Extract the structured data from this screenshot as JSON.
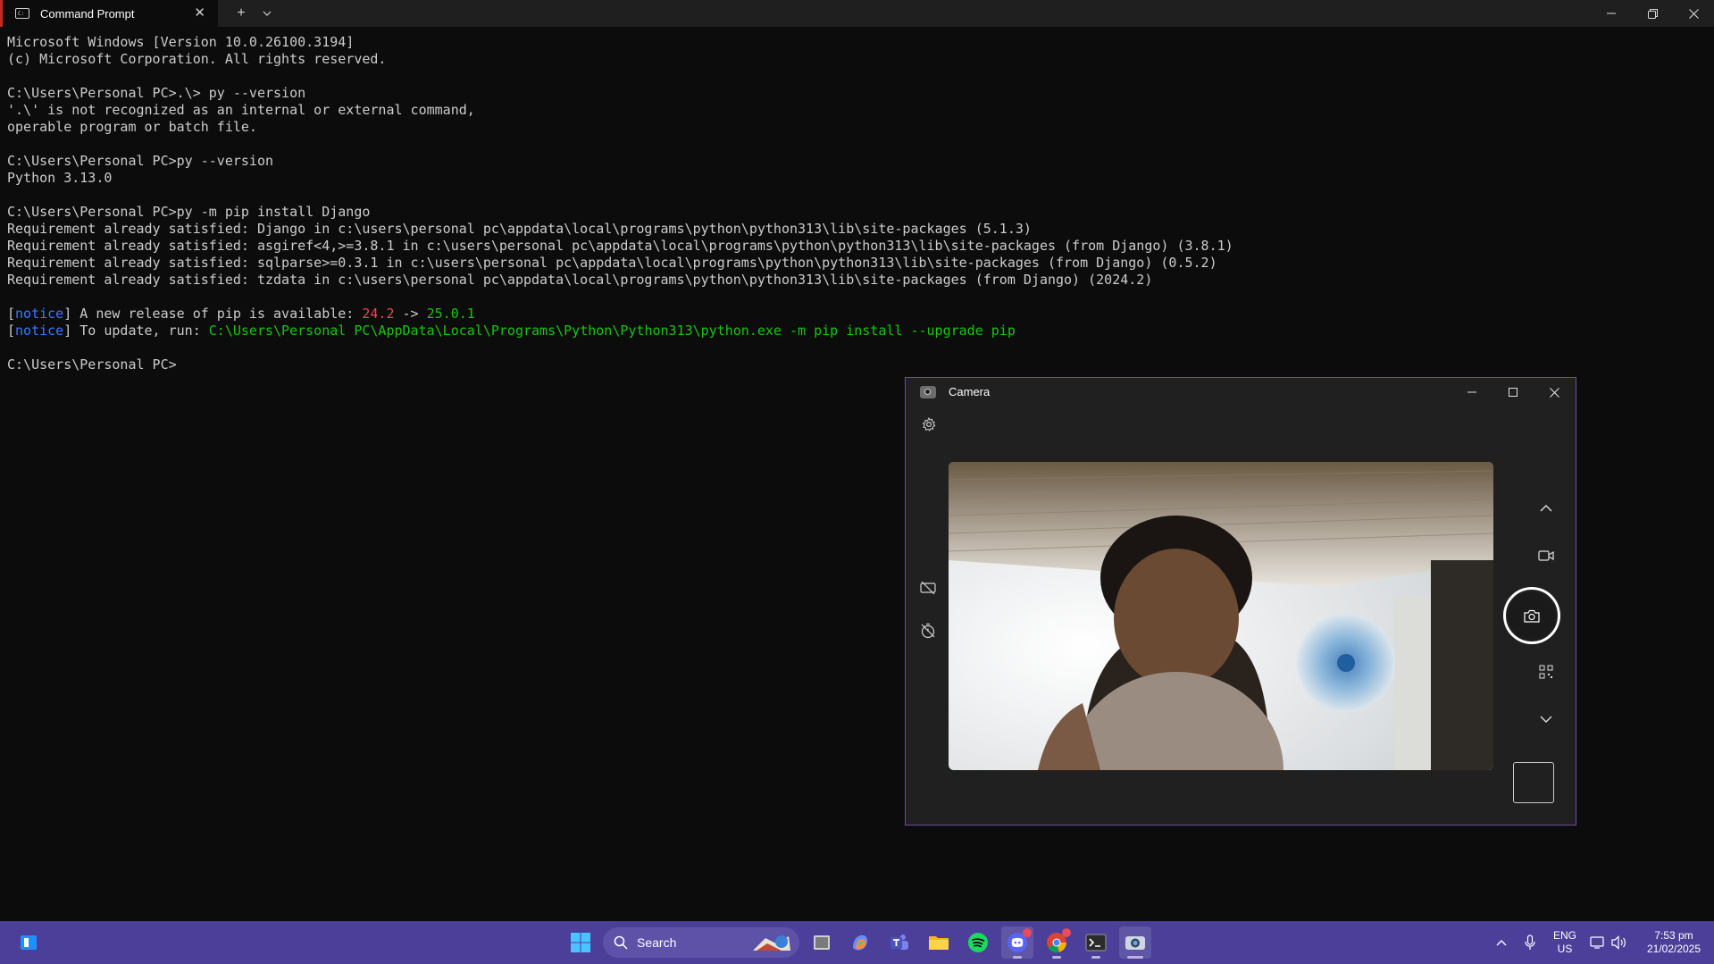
{
  "terminal": {
    "tab_title": "Command Prompt",
    "new_tab": "+",
    "dropdown": "⌄",
    "close": "✕",
    "lines": [
      {
        "segments": [
          {
            "t": "Microsoft Windows [Version 10.0.26100.3194]",
            "c": ""
          }
        ]
      },
      {
        "segments": [
          {
            "t": "(c) Microsoft Corporation. All rights reserved.",
            "c": ""
          }
        ]
      },
      {
        "segments": [
          {
            "t": "",
            "c": ""
          }
        ]
      },
      {
        "segments": [
          {
            "t": "C:\\Users\\Personal PC>.\\> py --version",
            "c": ""
          }
        ]
      },
      {
        "segments": [
          {
            "t": "'.\\' is not recognized as an internal or external command,",
            "c": ""
          }
        ]
      },
      {
        "segments": [
          {
            "t": "operable program or batch file.",
            "c": ""
          }
        ]
      },
      {
        "segments": [
          {
            "t": "",
            "c": ""
          }
        ]
      },
      {
        "segments": [
          {
            "t": "C:\\Users\\Personal PC>py --version",
            "c": ""
          }
        ]
      },
      {
        "segments": [
          {
            "t": "Python 3.13.0",
            "c": ""
          }
        ]
      },
      {
        "segments": [
          {
            "t": "",
            "c": ""
          }
        ]
      },
      {
        "segments": [
          {
            "t": "C:\\Users\\Personal PC>py -m pip install Django",
            "c": ""
          }
        ]
      },
      {
        "segments": [
          {
            "t": "Requirement already satisfied: Django in c:\\users\\personal pc\\appdata\\local\\programs\\python\\python313\\lib\\site-packages (5.1.3)",
            "c": ""
          }
        ]
      },
      {
        "segments": [
          {
            "t": "Requirement already satisfied: asgiref<4,>=3.8.1 in c:\\users\\personal pc\\appdata\\local\\programs\\python\\python313\\lib\\site-packages (from Django) (3.8.1)",
            "c": ""
          }
        ]
      },
      {
        "segments": [
          {
            "t": "Requirement already satisfied: sqlparse>=0.3.1 in c:\\users\\personal pc\\appdata\\local\\programs\\python\\python313\\lib\\site-packages (from Django) (0.5.2)",
            "c": ""
          }
        ]
      },
      {
        "segments": [
          {
            "t": "Requirement already satisfied: tzdata in c:\\users\\personal pc\\appdata\\local\\programs\\python\\python313\\lib\\site-packages (from Django) (2024.2)",
            "c": ""
          }
        ]
      },
      {
        "segments": [
          {
            "t": "",
            "c": ""
          }
        ]
      },
      {
        "segments": [
          {
            "t": "[",
            "c": ""
          },
          {
            "t": "notice",
            "c": "c-blue"
          },
          {
            "t": "] A new release of pip is available: ",
            "c": ""
          },
          {
            "t": "24.2",
            "c": "c-red"
          },
          {
            "t": " -> ",
            "c": ""
          },
          {
            "t": "25.0.1",
            "c": "c-green"
          }
        ]
      },
      {
        "segments": [
          {
            "t": "[",
            "c": ""
          },
          {
            "t": "notice",
            "c": "c-blue"
          },
          {
            "t": "] To update, run: ",
            "c": ""
          },
          {
            "t": "C:\\Users\\Personal PC\\AppData\\Local\\Programs\\Python\\Python313\\python.exe -m pip install --upgrade pip",
            "c": "c-green"
          }
        ]
      },
      {
        "segments": [
          {
            "t": "",
            "c": ""
          }
        ]
      },
      {
        "segments": [
          {
            "t": "C:\\Users\\Personal PC>",
            "c": ""
          }
        ]
      }
    ]
  },
  "camera": {
    "title": "Camera"
  },
  "taskbar": {
    "search_label": "Search",
    "language_top": "ENG",
    "language_bottom": "US",
    "time": "7:53 pm",
    "date": "21/02/2025"
  },
  "colors": {
    "console_bg": "#0c0c0c",
    "console_text": "#cccccc",
    "notice_blue": "#3b78ff",
    "old_version_red": "#e74856",
    "green": "#16c60c",
    "taskbar": "#4b3f9a",
    "camera_border": "#6b4fa0"
  }
}
